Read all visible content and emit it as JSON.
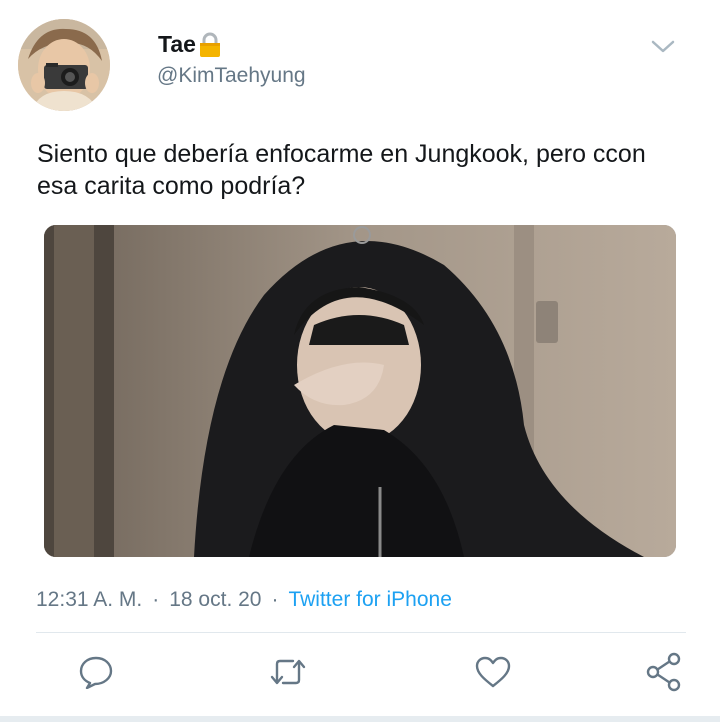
{
  "user": {
    "display_name": "Tae",
    "handle": "@KimTaehyung",
    "protected_icon": "lock-icon"
  },
  "tweet": {
    "text": "Siento que debería enfocarme en Jungkook, pero ccon\nesa carita como podría?",
    "time": "12:31 A. M.",
    "separator": "·",
    "date": "18 oct. 20",
    "source": "Twitter for iPhone"
  },
  "actions": {
    "icons": [
      "reply-icon",
      "retweet-icon",
      "like-icon",
      "share-icon"
    ]
  },
  "colors": {
    "text": "#14171a",
    "secondary": "#657786",
    "link": "#1da1f2",
    "divider": "#e1e8ed"
  }
}
